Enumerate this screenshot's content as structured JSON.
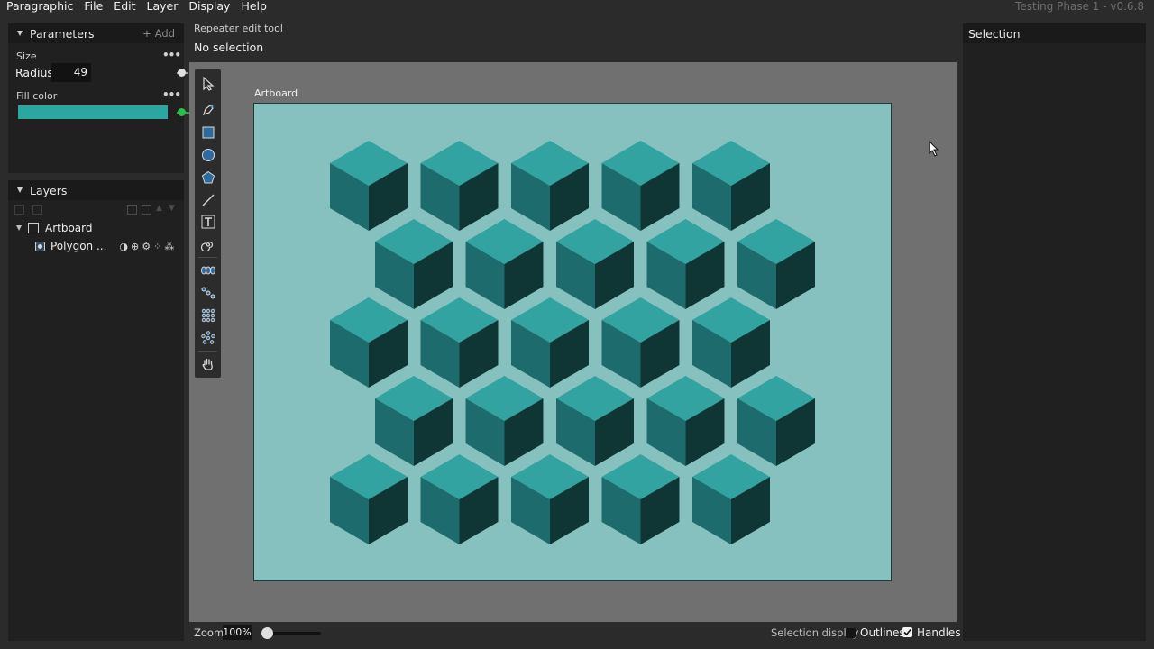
{
  "menubar": {
    "app": "Paragraphic",
    "items": [
      "File",
      "Edit",
      "Layer",
      "Display",
      "Help"
    ],
    "version": "Testing Phase 1 - v0.6.8"
  },
  "parameters": {
    "title": "Parameters",
    "add_label": "Add",
    "size_label": "Size",
    "radius_label": "Radius",
    "radius_value": "49",
    "fill_label": "Fill color",
    "fill_color": "#2ba6a0"
  },
  "layers": {
    "title": "Layers",
    "artboard_label": "Artboard",
    "polygon_label": "Polygon ..."
  },
  "tool": {
    "name": "Repeater edit tool",
    "status": "No selection"
  },
  "canvas": {
    "artboard_label": "Artboard",
    "artboard_color": "#87c1bf",
    "cube_colors": {
      "top": "#32a3a0",
      "left": "#1d6b6c",
      "right": "#0f3535"
    },
    "cube_rows": [
      5,
      5,
      5,
      5,
      5
    ]
  },
  "bottombar": {
    "zoom_label": "Zoom",
    "zoom_value": "100%",
    "zoom_level": 0.09,
    "selection_display_label": "Selection display",
    "outlines_label": "Outlines",
    "outlines_checked": false,
    "handles_label": "Handles",
    "handles_checked": true
  },
  "selection_panel": {
    "title": "Selection"
  }
}
